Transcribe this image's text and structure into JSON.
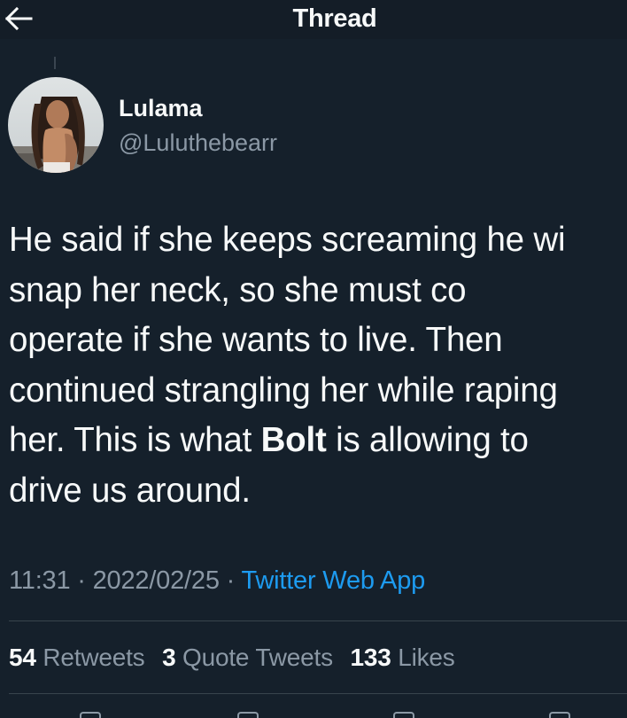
{
  "header": {
    "title": "Thread",
    "back_icon": "arrow-left-icon"
  },
  "tweet": {
    "author": {
      "display_name": "Lulama",
      "handle": "@Luluthebearr"
    },
    "text": {
      "line1": "He said if she keeps screaming he wi",
      "line2": "snap her neck, so she must co",
      "line3": "operate if she wants to live. Then",
      "line4": "continued strangling her while raping",
      "line5_before": "her. This is what ",
      "line5_bold": "Bolt",
      "line5_after": " is allowing to",
      "line6": "drive us around."
    },
    "time": "11:31",
    "date": "2022/02/25",
    "separator": "·",
    "source": "Twitter Web App"
  },
  "stats": {
    "retweets_count": "54",
    "retweets_label": "Retweets",
    "quotes_count": "3",
    "quotes_label": "Quote Tweets",
    "likes_count": "133",
    "likes_label": "Likes"
  },
  "colors": {
    "background": "#15202b",
    "text": "#f7f9f9",
    "secondary": "#8b98a5",
    "link": "#1d9bf0",
    "divider": "#38444d"
  }
}
